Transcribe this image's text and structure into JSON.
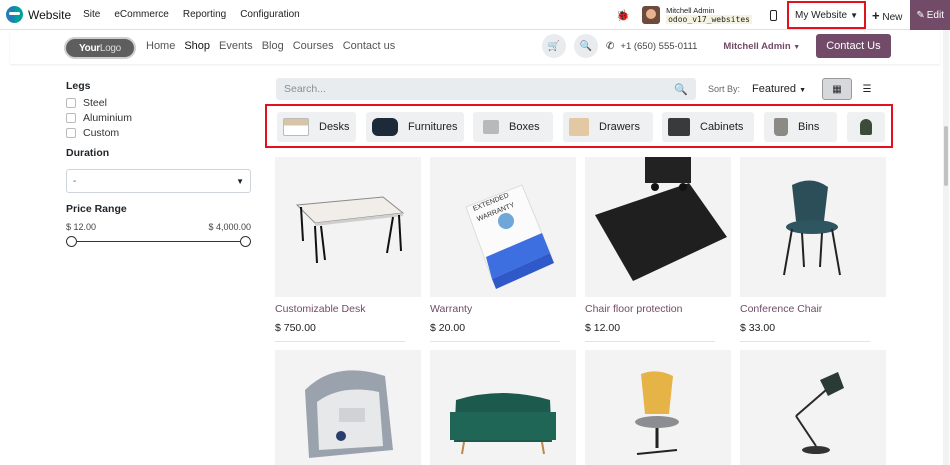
{
  "adminbar": {
    "brand": "Website",
    "menu": [
      "Site",
      "eCommerce",
      "Reporting",
      "Configuration"
    ],
    "user_name": "Mitchell Admin",
    "db_name": "odoo_v17_websites",
    "my_website_label": "My Website",
    "new_label": "New",
    "edit_label": "Edit"
  },
  "header": {
    "logo_bold": "Your",
    "logo_light": "Logo",
    "nav": [
      "Home",
      "Shop",
      "Events",
      "Blog",
      "Courses",
      "Contact us"
    ],
    "active_nav": "Shop",
    "phone": "+1 (650) 555-0111",
    "user": "Mitchell Admin",
    "contact_label": "Contact Us"
  },
  "filters": {
    "legs_title": "Legs",
    "legs_options": [
      "Steel",
      "Aluminium",
      "Custom"
    ],
    "duration_title": "Duration",
    "duration_value": "-",
    "price_title": "Price Range",
    "price_min": "$ 12.00",
    "price_max": "$ 4,000.00"
  },
  "toolbar": {
    "search_placeholder": "Search...",
    "sort_label": "Sort By:",
    "sort_value": "Featured"
  },
  "categories": [
    "Desks",
    "Furnitures",
    "Boxes",
    "Drawers",
    "Cabinets",
    "Bins",
    ""
  ],
  "products": [
    {
      "name": "Customizable Desk",
      "price": "$ 750.00"
    },
    {
      "name": "Warranty",
      "price": "$ 20.00"
    },
    {
      "name": "Chair floor protection",
      "price": "$ 12.00"
    },
    {
      "name": "Conference Chair",
      "price": "$ 33.00"
    }
  ],
  "warranty_box": {
    "line1": "EXTENDED",
    "line2": "WARRANTY"
  },
  "colors": {
    "brand": "#714b67",
    "highlight": "#e3101d"
  }
}
